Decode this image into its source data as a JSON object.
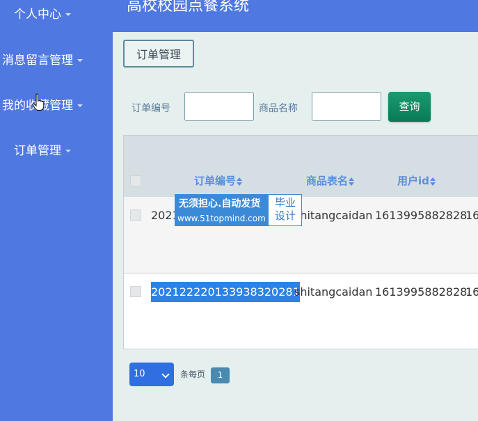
{
  "app": {
    "title": "高校校园点餐系统"
  },
  "sidebar": {
    "items": [
      {
        "label": "个人中心"
      },
      {
        "label": "消息留言管理"
      },
      {
        "label": "我的收藏管理"
      },
      {
        "label": "订单管理"
      }
    ]
  },
  "breadcrumb": {
    "label": "订单管理"
  },
  "filters": {
    "order_no_label": "订单编号",
    "order_no_value": "",
    "product_name_label": "商品名称",
    "product_name_value": "",
    "query_label": "查询"
  },
  "table": {
    "headers": [
      "订单编号",
      "商品表名",
      "用户id"
    ],
    "rows": [
      {
        "order_no": "2021",
        "table_name": "shitangcaidan",
        "user_id": "1613995882828",
        "next_col": "16"
      },
      {
        "order_no": "20212222013393832028​1",
        "table_name": "shitangcaidan",
        "user_id": "1613995882828",
        "next_col": "16"
      }
    ]
  },
  "watermark": {
    "line1": "无须担心.自动发货",
    "line2": "www.51topmind.com",
    "right_line1": "毕业",
    "right_line2": "设计"
  },
  "pagination": {
    "page_size": "10",
    "per_page_label": "条每页",
    "current_page": "1"
  },
  "colors": {
    "sidebar": "#4f79e0",
    "content_bg": "#e4efee",
    "query_button": "#0f8a60",
    "header_text": "#5b8de0",
    "selection": "#2d82e6"
  }
}
